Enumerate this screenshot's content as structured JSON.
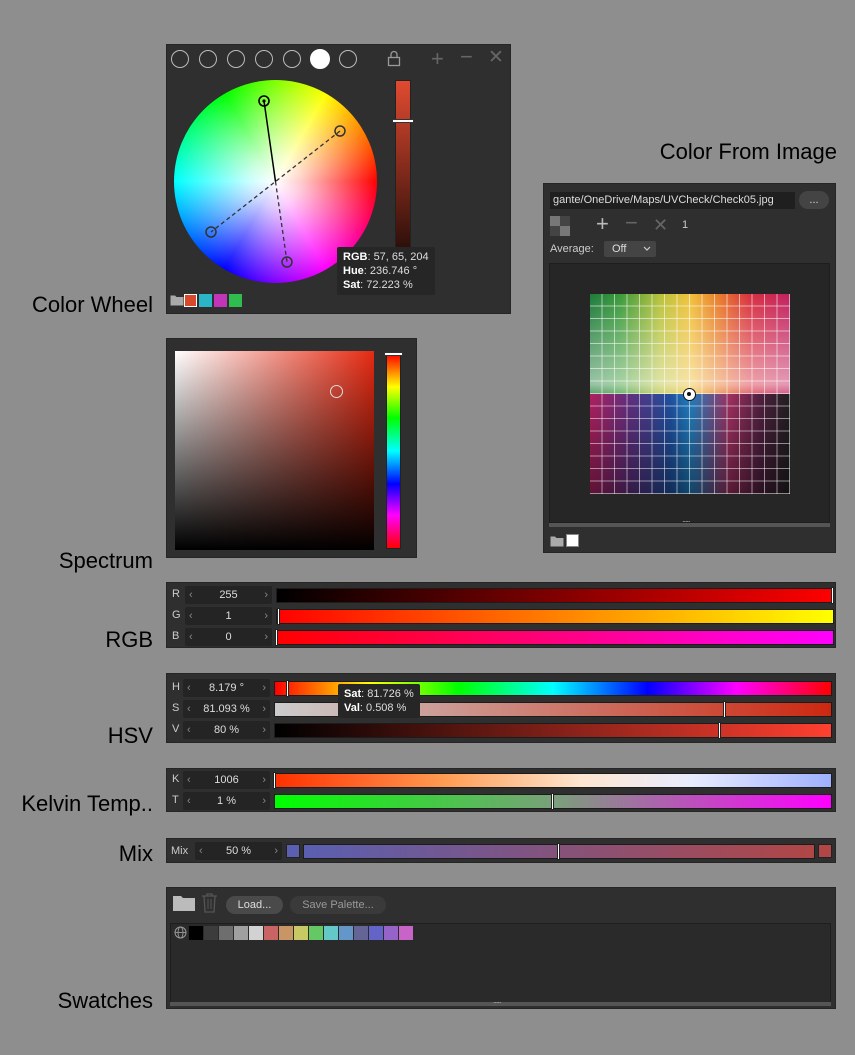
{
  "labels": {
    "color_wheel": "Color Wheel",
    "spectrum": "Spectrum",
    "rgb": "RGB",
    "hsv": "HSV",
    "kelvin": "Kelvin Temp..",
    "mix": "Mix",
    "swatches": "Swatches",
    "color_from_image": "Color From Image"
  },
  "wheel": {
    "tooltip": {
      "rgb_label": "RGB",
      "rgb_value": ": 57, 65, 204",
      "hue_label": "Hue",
      "hue_value": ": 236.746 °",
      "sat_label": "Sat",
      "sat_value": ": 72.223 %"
    },
    "value_bar_color": "#e04a30",
    "recent_swatches": [
      "#d8482c",
      "#2bb6c7",
      "#c235b8",
      "#2fbd4f"
    ]
  },
  "image": {
    "path": "gante/OneDrive/Maps/UVCheck/Check05.jpg",
    "more_label": "...",
    "count": "1",
    "average_label": "Average:",
    "average_value": "Off",
    "grip": "....."
  },
  "rgb": {
    "rows": [
      {
        "label": "R",
        "value": "255",
        "level": 1.0
      },
      {
        "label": "G",
        "value": "1",
        "level": 0.004
      },
      {
        "label": "B",
        "value": "0",
        "level": 0.0
      }
    ]
  },
  "hsv": {
    "rows": [
      {
        "label": "H",
        "value": "8.179 °",
        "level": 0.023
      },
      {
        "label": "S",
        "value": "81.093 %",
        "level": 0.81
      },
      {
        "label": "V",
        "value": "80 %",
        "level": 0.8
      }
    ],
    "tooltip": {
      "sat_label": "Sat",
      "sat_value": ": 81.726 %",
      "val_label": "Val",
      "val_value": ": 0.508 %"
    }
  },
  "kelvin": {
    "rows": [
      {
        "label": "K",
        "value": "1006",
        "level": 0.0
      },
      {
        "label": "T",
        "value": "1 %",
        "level": 0.5
      }
    ]
  },
  "mix": {
    "label": "Mix",
    "value": "50 %",
    "level": 0.5,
    "color_a": "#5a5fb0",
    "color_b": "#b04646"
  },
  "swatches": {
    "load_label": "Load...",
    "save_label": "Save Palette...",
    "grip": ".....",
    "colors": [
      "#000000",
      "#3c3c3c",
      "#6e6e6e",
      "#a0a0a0",
      "#d2d2d2",
      "#c86464",
      "#c89664",
      "#c8c864",
      "#64c864",
      "#64c8c8",
      "#6496c8",
      "#646496",
      "#6464c8",
      "#9664c8",
      "#c864c8"
    ]
  }
}
